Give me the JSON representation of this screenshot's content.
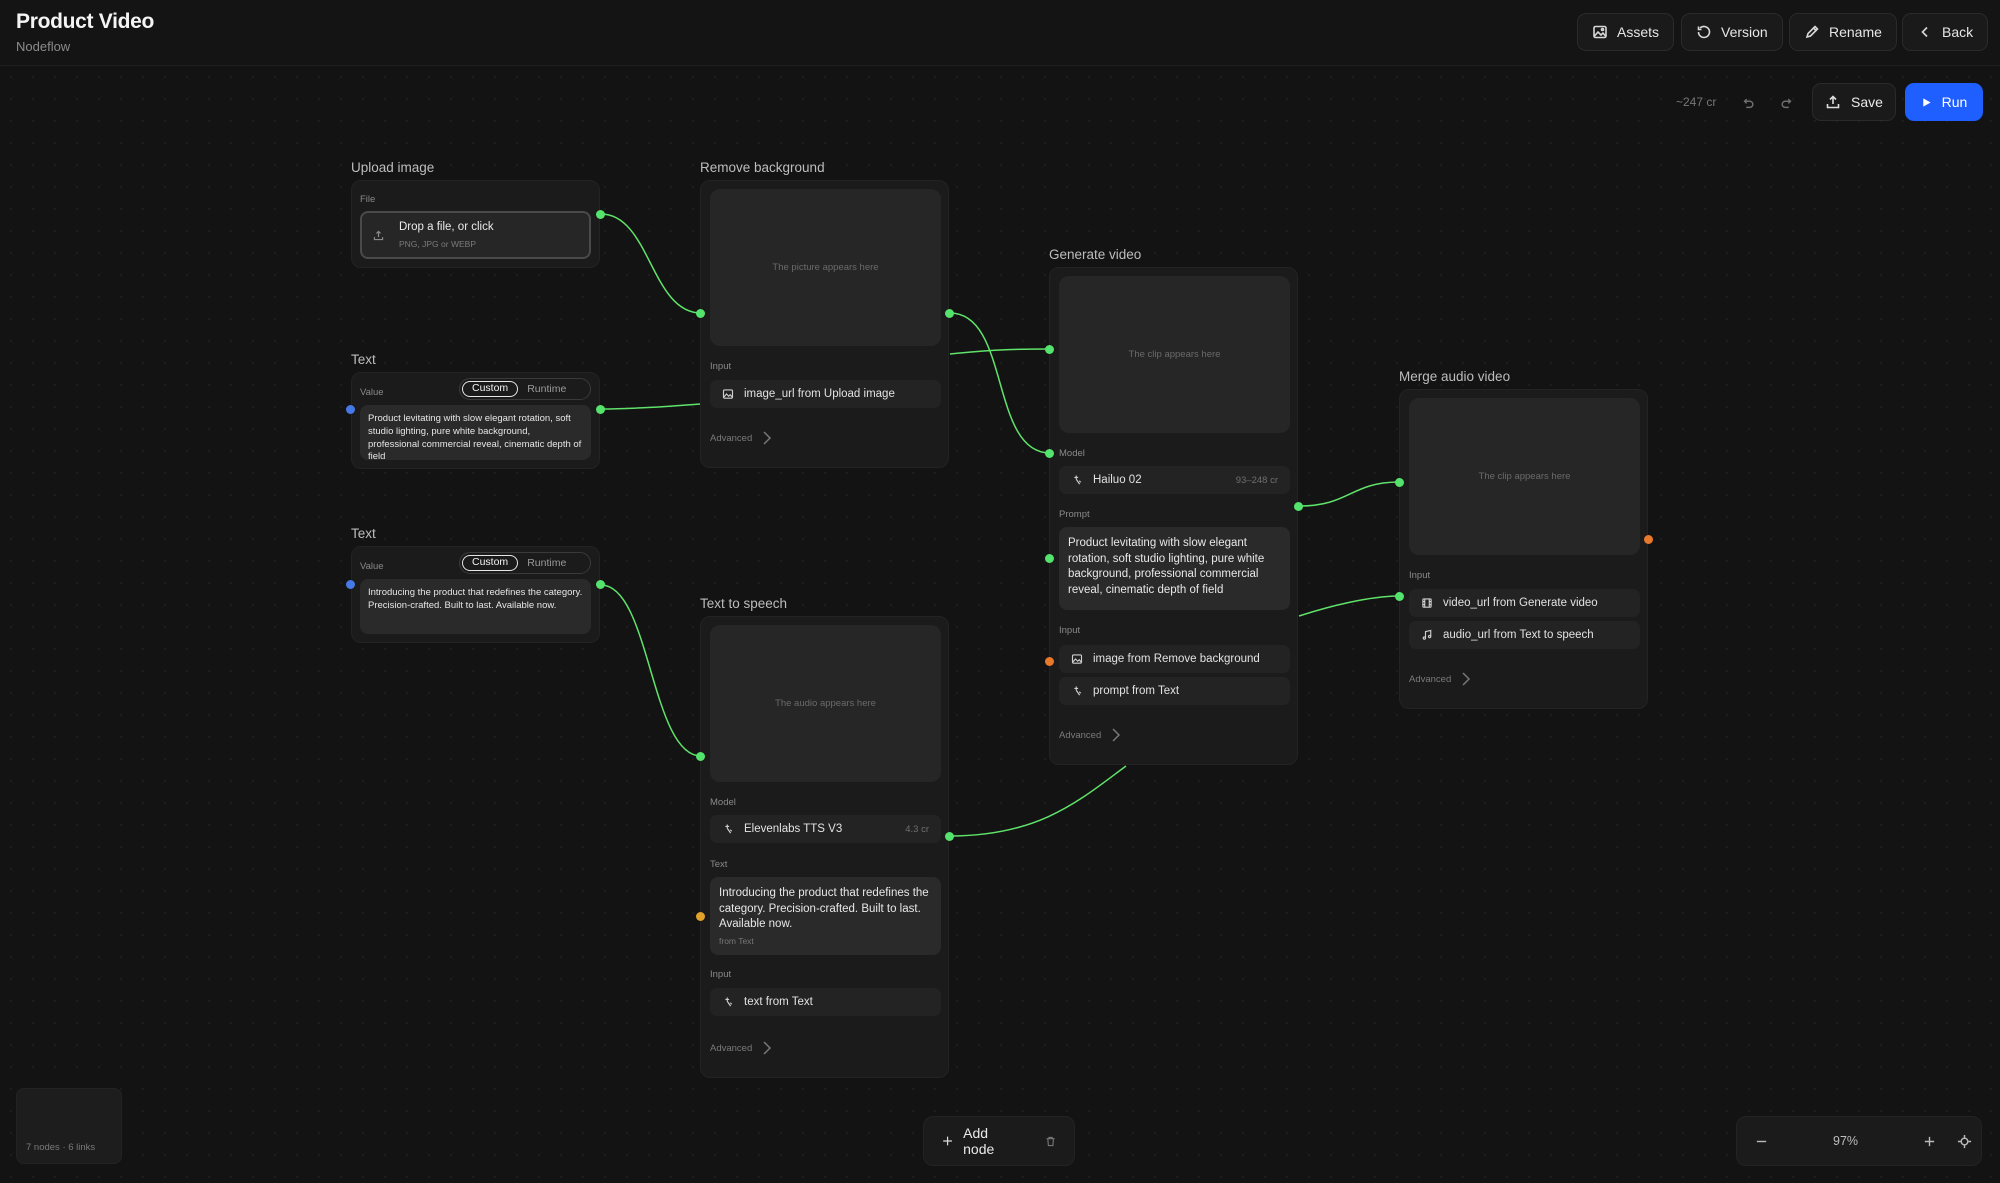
{
  "app": {
    "title": "Product Video",
    "subtitle": "Nodeflow"
  },
  "header_buttons": {
    "assets": "Assets",
    "version": "Version",
    "rename": "Rename",
    "back": "Back"
  },
  "toolbar": {
    "credits": "~247 cr",
    "save": "Save",
    "run": "Run"
  },
  "nodes": {
    "upload": {
      "title": "Upload image",
      "file_label": "File",
      "drop_title": "Drop a file, or click",
      "drop_sub": "PNG, JPG or WEBP"
    },
    "text1": {
      "title": "Text",
      "value_label": "Value",
      "toggle_custom": "Custom",
      "toggle_runtime": "Runtime",
      "value": "Product levitating with slow elegant rotation, soft studio lighting, pure white background, professional commercial reveal, cinematic depth of field"
    },
    "text2": {
      "title": "Text",
      "value_label": "Value",
      "toggle_custom": "Custom",
      "toggle_runtime": "Runtime",
      "value": "Introducing the product that redefines the category. Precision-crafted. Built to last. Available now."
    },
    "remove_bg": {
      "title": "Remove background",
      "preview": "The picture appears here",
      "input_label": "Input",
      "input_1": "image_url from Upload image",
      "advanced": "Advanced"
    },
    "tts": {
      "title": "Text to speech",
      "preview": "The audio appears here",
      "model_label": "Model",
      "model": "Elevenlabs TTS V3",
      "model_cost": "4.3 cr",
      "text_label": "Text",
      "text": "Introducing the product that redefines the category. Precision-crafted. Built to last. Available now.",
      "text_source": "from Text",
      "input_label": "Input",
      "input_1": "text from Text",
      "advanced": "Advanced"
    },
    "gen_video": {
      "title": "Generate video",
      "preview": "The clip appears here",
      "model_label": "Model",
      "model": "Hailuo 02",
      "model_cost": "93–248 cr",
      "prompt_label": "Prompt",
      "prompt": "Product levitating with slow elegant rotation, soft studio lighting, pure white background, professional commercial reveal, cinematic depth of field",
      "input_label": "Input",
      "input_1": "image from Remove background",
      "input_2": "prompt from Text",
      "advanced": "Advanced"
    },
    "merge": {
      "title": "Merge audio video",
      "preview": "The clip appears here",
      "input_label": "Input",
      "input_1": "video_url from Generate video",
      "input_2": "audio_url from Text to speech",
      "advanced": "Advanced"
    }
  },
  "bottom": {
    "stats": "7 nodes · 6 links",
    "add_node": "Add node",
    "zoom": "97%"
  },
  "colors": {
    "accent": "#1f5eff",
    "wire": "#5fe36a",
    "port_input": "#e8782c",
    "port_text": "#4679e6"
  }
}
